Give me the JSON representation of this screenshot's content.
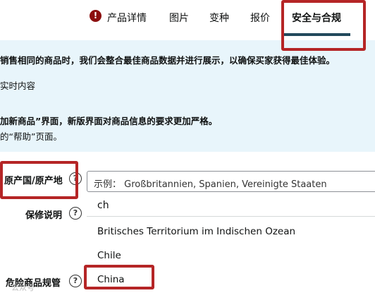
{
  "tabs": [
    {
      "label": "产品详情"
    },
    {
      "label": "图片"
    },
    {
      "label": "变种"
    },
    {
      "label": "报价"
    },
    {
      "label": "安全与合规"
    }
  ],
  "warning_icon": {
    "name": "exclamation-icon",
    "glyph": "!"
  },
  "banner": {
    "line1": "销售相同的商品时，我们会整合最佳商品数据并进行展示，以确保买家获得最佳体验。",
    "line2": "实时内容",
    "line3": "加新商品”界面，新版界面对商品信息的要求更加严格。",
    "line4": "的“帮助”页面。"
  },
  "form": {
    "origin_label": "原产国/原产地",
    "warranty_label": "保修说明",
    "hazmat_label": "危险商品规管",
    "help_glyph": "?",
    "origin_placeholder": "示例： Großbritannien, Spanien, Vereinigte Staaten",
    "search_value": "ch"
  },
  "dropdown": {
    "options": [
      "Britisches Territorium im Indischen Ozean",
      "Chile",
      "China"
    ]
  },
  "watermark": "公众号"
}
